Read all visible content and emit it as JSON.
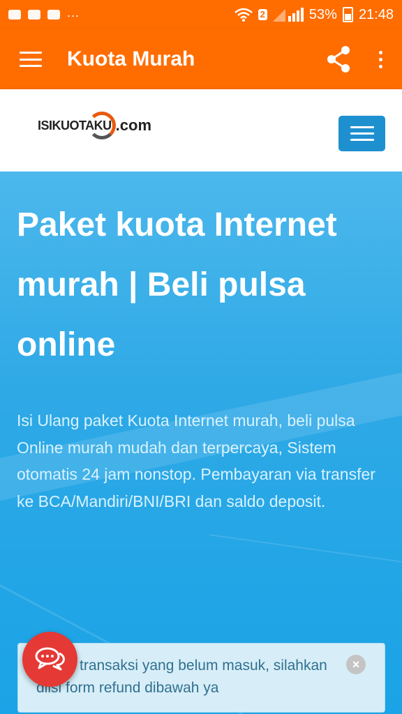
{
  "status_bar": {
    "sim_badge": "2",
    "battery": "53%",
    "time": "21:48",
    "overflow": "...",
    "icons": [
      "bbm-icon",
      "gallery-icon",
      "youtube-icon",
      "wifi-icon",
      "signal-icon",
      "battery-icon"
    ]
  },
  "app_bar": {
    "title": "Kuota Murah",
    "icons": [
      "menu-icon",
      "share-icon",
      "more-vert-icon"
    ]
  },
  "site": {
    "logo_text": "ISIKUOTAKU",
    "logo_suffix": ".com"
  },
  "hero": {
    "title": "Paket kuota Internet murah | Beli pulsa online",
    "description": "Isi Ulang paket Kuota Internet murah, beli pulsa Online murah mudah dan terpercaya, Sistem otomatis 24 jam nonstop. Pembayaran via transfer ke BCA/Mandiri/BNI/BRI dan saldo deposit."
  },
  "alert": {
    "line1": "transaksi yang belum masuk, silahkan",
    "line2": "diisi form refund dibawah ya"
  },
  "colors": {
    "app_bar": "#ff6d00",
    "hero": "#1ea9e6",
    "nav_toggle": "#1e90d0",
    "alert_bg": "#d7eef8",
    "chat_fab": "#e53935"
  }
}
